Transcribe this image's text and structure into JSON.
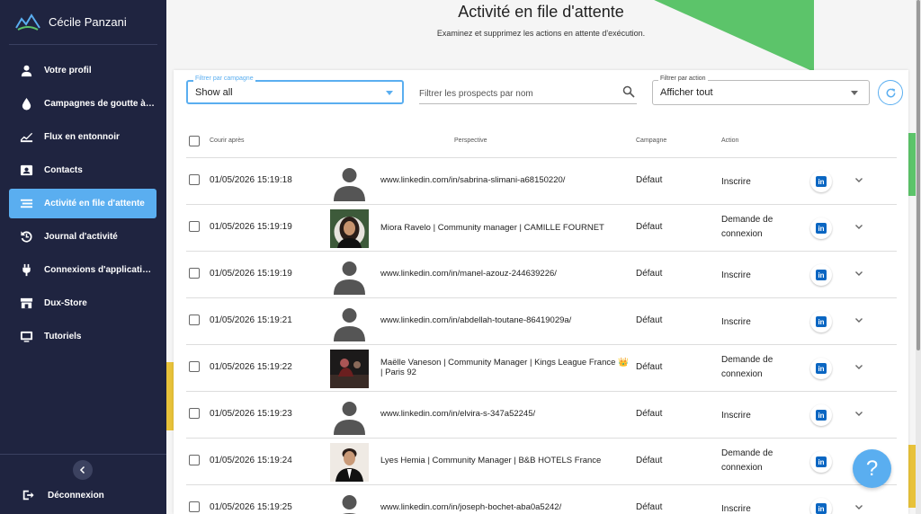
{
  "sidebar": {
    "user_name": "Cécile Panzani",
    "items": [
      {
        "label": "Votre profil",
        "icon": "person-icon",
        "active": false
      },
      {
        "label": "Campagnes de goutte à goutte",
        "icon": "drop-icon",
        "active": false
      },
      {
        "label": "Flux en entonnoir",
        "icon": "chart-icon",
        "active": false
      },
      {
        "label": "Contacts",
        "icon": "contacts-icon",
        "active": false
      },
      {
        "label": "Activité en file d'attente",
        "icon": "queue-icon",
        "active": true
      },
      {
        "label": "Journal d'activité",
        "icon": "history-icon",
        "active": false
      },
      {
        "label": "Connexions d'applications",
        "icon": "plug-icon",
        "active": false
      },
      {
        "label": "Dux-Store",
        "icon": "store-icon",
        "active": false
      },
      {
        "label": "Tutoriels",
        "icon": "tutorial-icon",
        "active": false
      }
    ],
    "logout_label": "Déconnexion"
  },
  "header": {
    "title": "Activité en file d'attente",
    "subtitle": "Examinez et supprimez les actions en attente d'exécution."
  },
  "filters": {
    "campaign_label": "Filtrer par campagne",
    "campaign_value": "Show all",
    "search_placeholder": "Filtrer les prospects par nom",
    "action_label": "Filtrer par action",
    "action_value": "Afficher tout"
  },
  "table": {
    "headers": {
      "run_after": "Courir après",
      "prospect": "Perspective",
      "campaign": "Campagne",
      "action": "Action"
    },
    "rows": [
      {
        "date": "01/05/2026 15:19:18",
        "prospect": "www.linkedin.com/in/sabrina-slimani-a68150220/",
        "campaign": "Défaut",
        "action": "Inscrire",
        "avatar": "placeholder"
      },
      {
        "date": "01/05/2026 15:19:19",
        "prospect": "Miora Ravelo | Community manager  | CAMILLE FOURNET",
        "campaign": "Défaut",
        "action": "Demande de connexion",
        "avatar": "photo-woman"
      },
      {
        "date": "01/05/2026 15:19:19",
        "prospect": "www.linkedin.com/in/manel-azouz-244639226/",
        "campaign": "Défaut",
        "action": "Inscrire",
        "avatar": "placeholder"
      },
      {
        "date": "01/05/2026 15:19:21",
        "prospect": "www.linkedin.com/in/abdellah-toutane-86419029a/",
        "campaign": "Défaut",
        "action": "Inscrire",
        "avatar": "placeholder"
      },
      {
        "date": "01/05/2026 15:19:22",
        "prospect": "Maëlle Vaneson | Community Manager | Kings League France 👑 | Paris 92",
        "campaign": "Défaut",
        "action": "Demande de connexion",
        "avatar": "photo-event"
      },
      {
        "date": "01/05/2026 15:19:23",
        "prospect": "www.linkedin.com/in/elvira-s-347a52245/",
        "campaign": "Défaut",
        "action": "Inscrire",
        "avatar": "placeholder"
      },
      {
        "date": "01/05/2026 15:19:24",
        "prospect": "Lyes Hemia | Community Manager  | B&B HOTELS France",
        "campaign": "Défaut",
        "action": "Demande de connexion",
        "avatar": "photo-man"
      },
      {
        "date": "01/05/2026 15:19:25",
        "prospect": "www.linkedin.com/in/joseph-bochet-aba0a5242/",
        "campaign": "Défaut",
        "action": "Inscrire",
        "avatar": "placeholder"
      }
    ]
  },
  "help_label": "?",
  "colors": {
    "sidebar_bg": "#1f2440",
    "accent": "#5aaef0",
    "linkedin": "#0a66c2",
    "deco_green": "#5cc46a",
    "deco_yellow": "#e8c23a"
  }
}
